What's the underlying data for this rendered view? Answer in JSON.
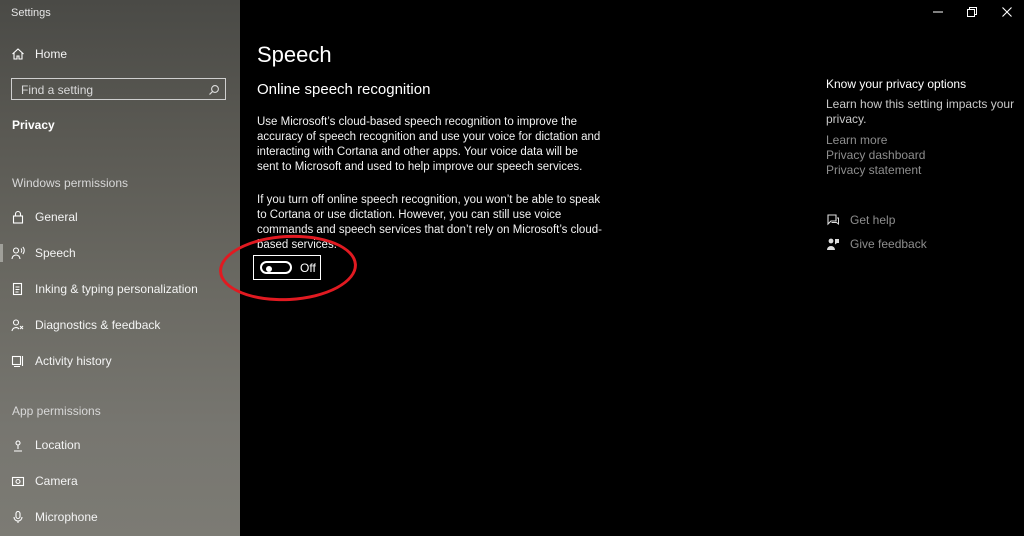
{
  "window": {
    "title": "Settings"
  },
  "sidebar": {
    "home": "Home",
    "search_placeholder": "Find a setting",
    "category": "Privacy",
    "windows_permissions_header": "Windows permissions",
    "windows_items": [
      {
        "label": "General",
        "icon": "lock-icon"
      },
      {
        "label": "Speech",
        "icon": "speech-icon"
      },
      {
        "label": "Inking & typing personalization",
        "icon": "inking-icon"
      },
      {
        "label": "Diagnostics & feedback",
        "icon": "diagnostics-icon"
      },
      {
        "label": "Activity history",
        "icon": "activity-history-icon"
      }
    ],
    "app_permissions_header": "App permissions",
    "app_items": [
      {
        "label": "Location",
        "icon": "location-icon"
      },
      {
        "label": "Camera",
        "icon": "camera-icon"
      },
      {
        "label": "Microphone",
        "icon": "microphone-icon"
      }
    ],
    "selected": "Speech"
  },
  "main": {
    "title": "Speech",
    "subtitle": "Online speech recognition",
    "paragraph1": "Use Microsoft’s cloud-based speech recognition to improve the accuracy of speech recognition and use your voice for dictation and interacting with Cortana and other apps. Your voice data will be sent to Microsoft and used to help improve our speech services.",
    "paragraph2": "If you turn off online speech recognition, you won’t be able to speak to Cortana or use dictation. However, you can still use voice commands and speech services that don’t rely on Microsoft’s cloud-based services.",
    "toggle_state": "Off"
  },
  "right": {
    "title": "Know your privacy options",
    "description": "Learn how this setting impacts your privacy.",
    "links": [
      "Learn more",
      "Privacy dashboard",
      "Privacy statement"
    ],
    "get_help": "Get help",
    "give_feedback": "Give feedback"
  },
  "colors": {
    "annotation_circle": "#e11a21",
    "sidebar_bg": "#6b6a63",
    "main_bg": "#000000"
  }
}
